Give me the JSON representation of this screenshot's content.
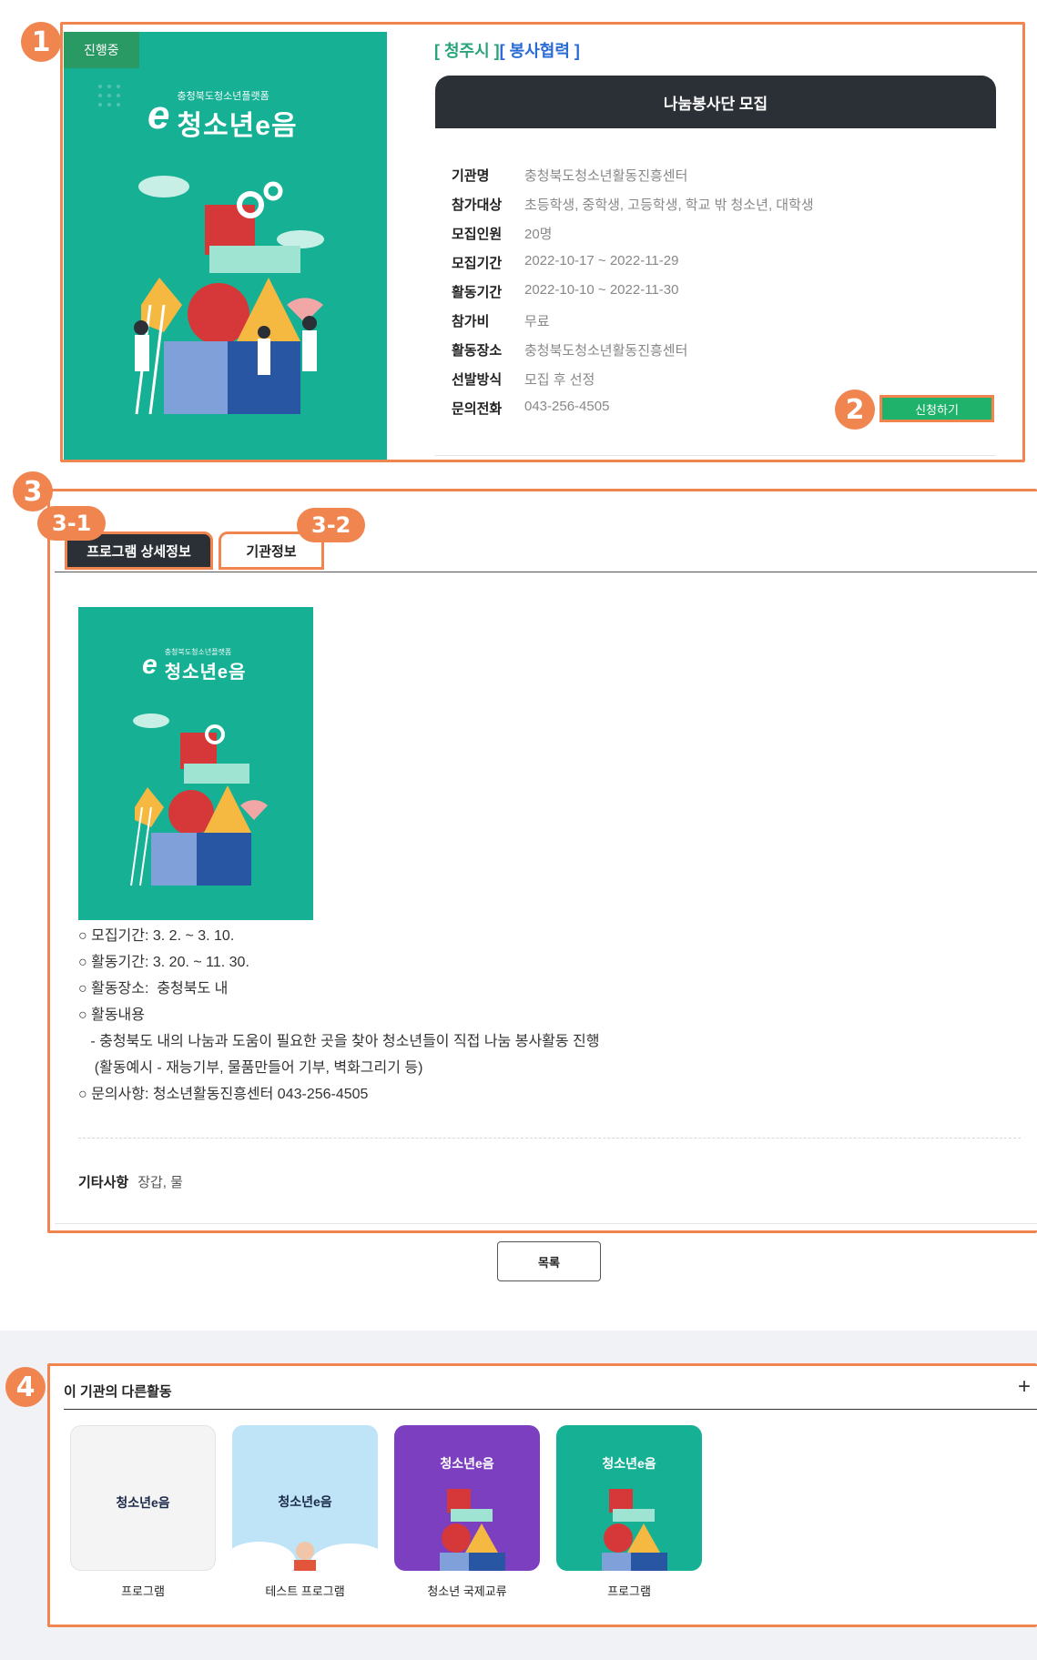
{
  "annotations": {
    "n1": "1",
    "n2": "2",
    "n3": "3",
    "n31": "3-1",
    "n32": "3-2",
    "n4": "4"
  },
  "poster": {
    "status": "진행중",
    "logo_sub": "충청북도청소년플랫폼",
    "logo_main": "청소년e음",
    "logo_e": "e"
  },
  "program": {
    "category_region": "[ 청주시 ]",
    "category_type": "[ 봉사협력 ]",
    "title": "나눔봉사단 모집",
    "fields": [
      {
        "k": "기관명",
        "v": "충청북도청소년활동진흥센터"
      },
      {
        "k": "참가대상",
        "v": "초등학생, 중학생, 고등학생, 학교 밖 청소년, 대학생"
      },
      {
        "k": "모집인원",
        "v": "20명"
      },
      {
        "k": "모집기간",
        "v": "2022-10-17 ~ 2022-11-29"
      },
      {
        "k": "활동기간",
        "v": "2022-10-10 ~ 2022-11-30"
      },
      {
        "k": "참가비",
        "v": "무료"
      },
      {
        "k": "활동장소",
        "v": "충청북도청소년활동진흥센터"
      },
      {
        "k": "선발방식",
        "v": "모집 후 선정"
      },
      {
        "k": "문의전화",
        "v": "043-256-4505"
      }
    ],
    "apply_label": "신청하기"
  },
  "tabs": {
    "detail": "프로그램 상세정보",
    "org": "기관정보"
  },
  "detail": {
    "lines": [
      "○ 모집기간: 3. 2. ~ 3. 10.",
      "○ 활동기간: 3. 20. ~ 11. 30.",
      "○ 활동장소:  충청북도 내",
      "○ 활동내용",
      "   - 충청북도 내의 나눔과 도움이 필요한 곳을 찾아 청소년들이 직접 나눔 봉사활동 진행",
      "    (활동예시 - 재능기부, 물품만들어 기부, 벽화그리기 등)",
      "○ 문의사항: 청소년활동진흥센터 043-256-4505"
    ],
    "etc_key": "기타사항",
    "etc_value": "장갑, 물"
  },
  "list_button": "목록",
  "other": {
    "title": "이 기관의 다른활동",
    "plus": "+",
    "cards": [
      {
        "label": "프로그램",
        "bg": "#f4f4f4",
        "logo": "청소년e음"
      },
      {
        "label": "테스트 프로그램",
        "bg": "#bfe3f7",
        "logo": "청소년e음"
      },
      {
        "label": "청소년 국제교류",
        "bg": "#7b3fbf",
        "logo": "청소년e음"
      },
      {
        "label": "프로그램",
        "bg": "#16b095",
        "logo": "청소년e음"
      }
    ]
  },
  "colors": {
    "accent": "#f08550",
    "brand_green": "#16b095",
    "dark": "#2b2f36",
    "apply": "#1fb26b"
  }
}
